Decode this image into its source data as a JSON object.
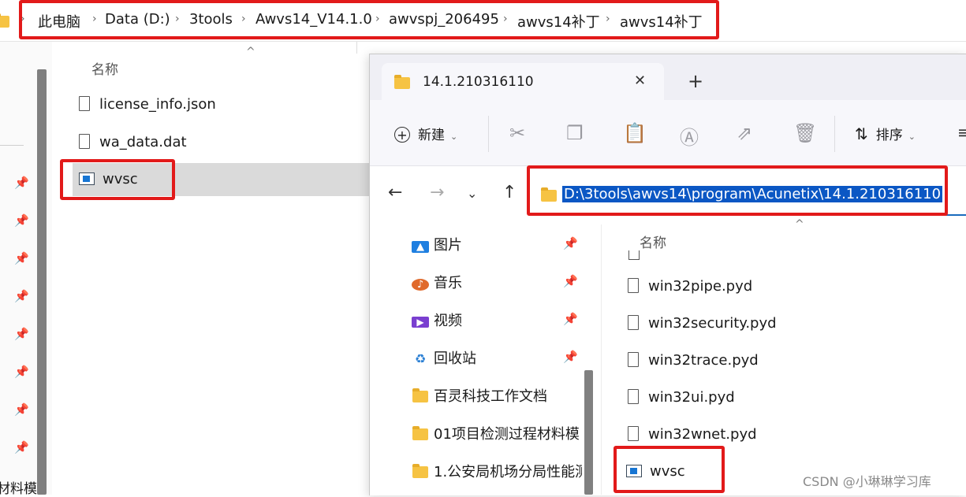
{
  "breadcrumb": {
    "items": [
      "此电脑",
      "Data (D:)",
      "3tools",
      "Awvs14_V14.1.0",
      "awvspj_206495",
      "awvs14补丁",
      "awvs14补丁"
    ]
  },
  "background_explorer": {
    "column_header": "名称",
    "files": [
      {
        "name": "license_info.json",
        "icon": "file-icon"
      },
      {
        "name": "wa_data.dat",
        "icon": "file-icon"
      },
      {
        "name": "wvsc",
        "icon": "app-icon"
      }
    ],
    "left_pane_partial_text": "材料模"
  },
  "foreground_window": {
    "tab_title": "14.1.210316110",
    "new_tab_symbol": "+",
    "close_tab_symbol": "✕",
    "toolbar": {
      "new_label": "新建",
      "sort_label": "排序"
    },
    "address": "D:\\3tools\\awvs14\\program\\Acunetix\\14.1.210316110",
    "column_header": "名称",
    "sidebar": [
      {
        "label": "图片",
        "icon": "pictures-icon",
        "pinned": true
      },
      {
        "label": "音乐",
        "icon": "music-icon",
        "pinned": true
      },
      {
        "label": "视频",
        "icon": "videos-icon",
        "pinned": true
      },
      {
        "label": "回收站",
        "icon": "recycle-bin-icon",
        "pinned": true
      },
      {
        "label": "百灵科技工作文档",
        "icon": "folder-icon",
        "pinned": false
      },
      {
        "label": "01项目检测过程材料模",
        "icon": "folder-icon",
        "pinned": false
      },
      {
        "label": "1.公安局机场分局性能测",
        "icon": "folder-icon",
        "pinned": false
      }
    ],
    "files": [
      {
        "name": "win32pipe.pyd",
        "icon": "file-icon"
      },
      {
        "name": "win32security.pyd",
        "icon": "file-icon"
      },
      {
        "name": "win32trace.pyd",
        "icon": "file-icon"
      },
      {
        "name": "win32ui.pyd",
        "icon": "file-icon"
      },
      {
        "name": "win32wnet.pyd",
        "icon": "file-icon"
      },
      {
        "name": "wvsc",
        "icon": "app-icon"
      }
    ]
  },
  "watermark": "CSDN @小琳琳学习库",
  "colors": {
    "highlight_red": "#e21a1a",
    "selection_blue": "#0b57c4",
    "folder_yellow": "#f6c343"
  }
}
